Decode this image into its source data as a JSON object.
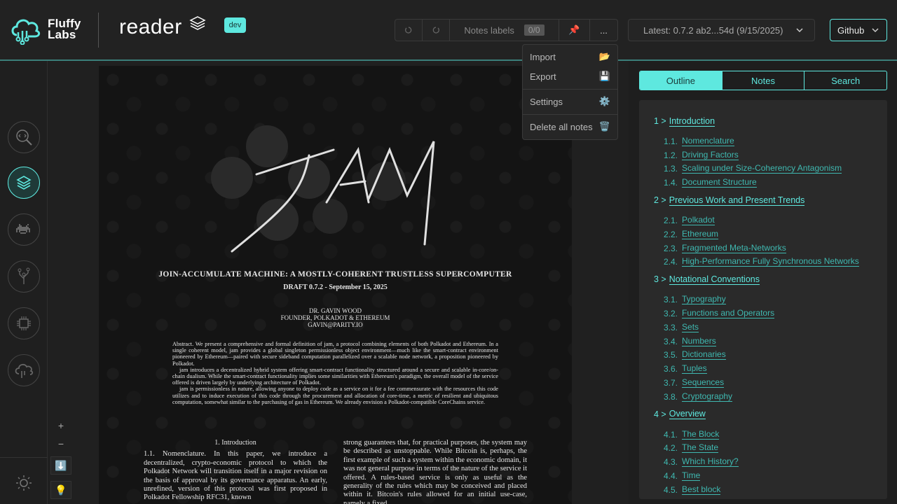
{
  "header": {
    "brand_line1": "Fluffy",
    "brand_line2": "Labs",
    "app_title": "reader",
    "badge": "dev",
    "toolbar": {
      "undo_icon": "undo-icon",
      "redo_icon": "redo-icon",
      "notes_labels": "Notes labels",
      "notes_count": "0/0",
      "pin_icon": "pin-icon",
      "more_label": "..."
    },
    "version": "Latest: 0.7.2 ab2...54d (9/15/2025)",
    "github": "Github"
  },
  "menu": {
    "items": [
      {
        "label": "Import",
        "icon": "📂"
      },
      {
        "label": "Export",
        "icon": "💾"
      },
      {
        "label": "Settings",
        "icon": "⚙️"
      },
      {
        "label": "Delete all notes",
        "icon": "🗑️"
      }
    ]
  },
  "zoom": {
    "in": "+",
    "out": "−",
    "download": "⬇️",
    "tip": "💡"
  },
  "paper": {
    "title": "JOIN-ACCUMULATE MACHINE: A MOSTLY-COHERENT TRUSTLESS SUPERCOMPUTER",
    "draft": "DRAFT 0.7.2 - September 15, 2025",
    "author1": "DR. GAVIN WOOD",
    "author2": "FOUNDER, POLKADOT & ETHEREUM",
    "author3": "GAVIN@PARITY.IO",
    "abstract1": "Abstract. We present a comprehensive and formal definition of jam, a protocol combining elements of both Polkadot and Ethereum. In a single coherent model, jam provides a global singleton permissionless object environment—much like the smart-contract environment pioneered by Ethereum—paired with secure sideband computation parallelized over a scalable node network, a proposition pioneered by Polkadot.",
    "abstract2": "jam introduces a decentralized hybrid system offering smart-contract functionality structured around a secure and scalable in-core/on-chain dualism. While the smart-contract functionality implies some similarities with Ethereum's paradigm, the overall model of the service offered is driven largely by underlying architecture of Polkadot.",
    "abstract3": "jam is permissionless in nature, allowing anyone to deploy code as a service on it for a fee commensurate with the resources this code utilizes and to induce execution of this code through the procurement and allocation of core-time, a metric of resilient and ubiquitous computation, somewhat similar to the purchasing of gas in Ethereum. We already envision a Polkadot-compatible CoreChains service.",
    "intro_heading": "1. Introduction",
    "col1": "1.1. Nomenclature. In this paper, we introduce a decentralized, crypto-economic protocol to which the Polkadot Network will transition itself in a major revision on the basis of approval by its governance apparatus. An early, unrefined, version of this protocol was first proposed in Polkadot Fellowship RFC31, known",
    "col2": "strong guarantees that, for practical purposes, the system may be described as unstoppable. While Bitcoin is, perhaps, the first example of such a system within the economic domain, it was not general purpose in terms of the nature of the service it offered. A rules-based service is only as useful as the generality of the rules which may be conceived and placed within it. Bitcoin's rules allowed for an initial use-case, namely a fixed"
  },
  "right_panel": {
    "tabs": [
      "Outline",
      "Notes",
      "Search"
    ],
    "outline": [
      {
        "num": "1 >",
        "title": "Introduction",
        "subs": [
          {
            "num": "1.1.",
            "title": "Nomenclature"
          },
          {
            "num": "1.2.",
            "title": "Driving Factors"
          },
          {
            "num": "1.3.",
            "title": "Scaling under Size-Coherency Antagonism"
          },
          {
            "num": "1.4.",
            "title": "Document Structure"
          }
        ]
      },
      {
        "num": "2 >",
        "title": "Previous Work and Present Trends",
        "subs": [
          {
            "num": "2.1.",
            "title": "Polkadot"
          },
          {
            "num": "2.2.",
            "title": "Ethereum"
          },
          {
            "num": "2.3.",
            "title": "Fragmented Meta-Networks"
          },
          {
            "num": "2.4.",
            "title": "High-Performance Fully Synchronous Networks"
          }
        ]
      },
      {
        "num": "3 >",
        "title": "Notational Conventions",
        "subs": [
          {
            "num": "3.1.",
            "title": "Typography"
          },
          {
            "num": "3.2.",
            "title": "Functions and Operators"
          },
          {
            "num": "3.3.",
            "title": "Sets"
          },
          {
            "num": "3.4.",
            "title": "Numbers"
          },
          {
            "num": "3.5.",
            "title": "Dictionaries"
          },
          {
            "num": "3.6.",
            "title": "Tuples"
          },
          {
            "num": "3.7.",
            "title": "Sequences"
          },
          {
            "num": "3.8.",
            "title": "Cryptography"
          }
        ]
      },
      {
        "num": "4 >",
        "title": "Overview",
        "subs": [
          {
            "num": "4.1.",
            "title": "The Block"
          },
          {
            "num": "4.2.",
            "title": "The State"
          },
          {
            "num": "4.3.",
            "title": "Which History?"
          },
          {
            "num": "4.4.",
            "title": "Time"
          },
          {
            "num": "4.5.",
            "title": "Best block"
          }
        ]
      }
    ]
  },
  "colors": {
    "accent": "#5ee8df",
    "background": "#1e1e1e"
  }
}
